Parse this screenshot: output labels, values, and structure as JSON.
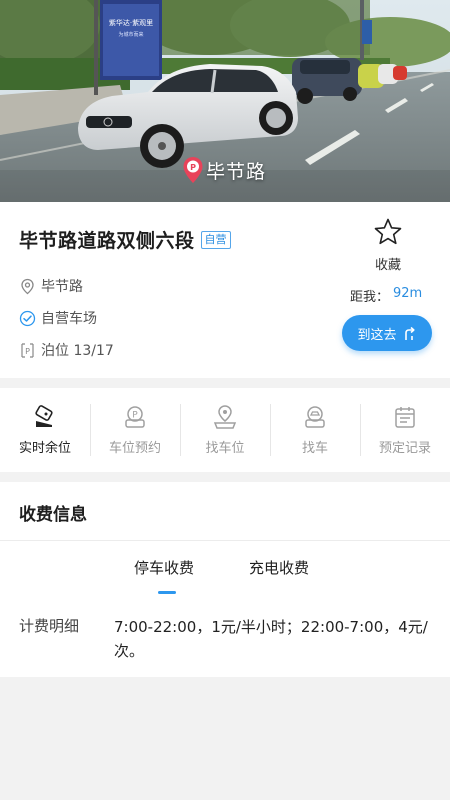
{
  "hero": {
    "road_caption": "毕节路",
    "billboard_line1": "紫华达·紫观里",
    "billboard_line2": "为城市而来"
  },
  "lot": {
    "title": "毕节路道路双侧六段",
    "badge": "自营",
    "address": "毕节路",
    "operator": "自营车场",
    "berth_text": "泊位 13/17",
    "favorite_label": "收藏",
    "distance_label": "距我：",
    "distance_value": "92m",
    "navigate_label": "到这去"
  },
  "toolbar": {
    "items": [
      {
        "label": "实时余位",
        "icon": "camera-icon",
        "active": true
      },
      {
        "label": "车位预约",
        "icon": "parking-booking-icon",
        "active": false
      },
      {
        "label": "找车位",
        "icon": "find-space-icon",
        "active": false
      },
      {
        "label": "找车",
        "icon": "find-car-icon",
        "active": false
      },
      {
        "label": "预定记录",
        "icon": "calendar-icon",
        "active": false
      }
    ]
  },
  "fees": {
    "heading": "收费信息",
    "tabs": [
      {
        "label": "停车收费",
        "selected": true
      },
      {
        "label": "充电收费",
        "selected": false
      }
    ],
    "row_label": "计费明细",
    "row_value": "7:00-22:00，1元/半小时；22:00-7:00，4元/次。"
  },
  "colors": {
    "accent": "#2d97ee",
    "pin": "#e8435a",
    "background": "#f2f2f2"
  }
}
